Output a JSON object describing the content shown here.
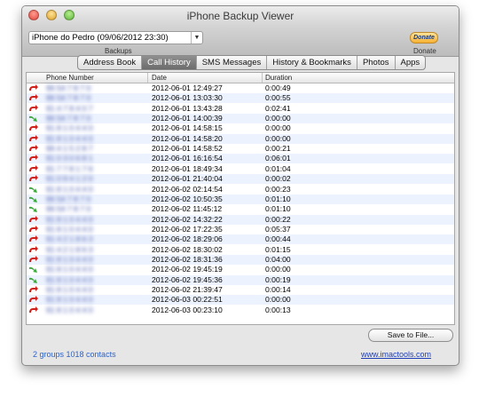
{
  "window": {
    "title": "iPhone Backup Viewer"
  },
  "toolbar": {
    "device": "iPhone do Pedro (09/06/2012 23:30)",
    "backups_label": "Backups",
    "donate_button": "Donate",
    "donate_label": "Donate"
  },
  "tabs": [
    {
      "label": "Address Book",
      "selected": false
    },
    {
      "label": "Call History",
      "selected": true
    },
    {
      "label": "SMS Messages",
      "selected": false
    },
    {
      "label": "History & Bookmarks",
      "selected": false
    },
    {
      "label": "Photos",
      "selected": false
    },
    {
      "label": "Apps",
      "selected": false
    }
  ],
  "table": {
    "columns": [
      "Phone Number",
      "Date",
      "Duration"
    ],
    "rows": [
      {
        "type": "missed",
        "number": "96 54 7 8 7 0",
        "date": "2012-06-01 12:49:27",
        "duration": "0:00:49"
      },
      {
        "type": "missed",
        "number": "96 54 7 8 7 0",
        "date": "2012-06-01 13:03:30",
        "duration": "0:00:55"
      },
      {
        "type": "missed",
        "number": "91 4 7 8 4 0 7",
        "date": "2012-06-01 13:43:28",
        "duration": "0:02:41"
      },
      {
        "type": "incoming",
        "number": "96 54 7 8 7 0",
        "date": "2012-06-01 14:00:39",
        "duration": "0:00:00"
      },
      {
        "type": "missed",
        "number": "91 8 1 0 4 4 0",
        "date": "2012-06-01 14:58:15",
        "duration": "0:00:00"
      },
      {
        "type": "missed",
        "number": "91 8 1 0 4 4 0",
        "date": "2012-06-01 14:58:20",
        "duration": "0:00:00"
      },
      {
        "type": "missed",
        "number": "96 4 1 5 2 8 7",
        "date": "2012-06-01 14:58:52",
        "duration": "0:00:21"
      },
      {
        "type": "missed",
        "number": "91 0 3 0 6 8 1",
        "date": "2012-06-01 16:16:54",
        "duration": "0:06:01"
      },
      {
        "type": "missed",
        "number": "91 7 7 8 1 7 6",
        "date": "2012-06-01 18:49:34",
        "duration": "0:01:04"
      },
      {
        "type": "missed",
        "number": "91 0 9 4 1 2 0",
        "date": "2012-06-01 21:40:04",
        "duration": "0:00:02"
      },
      {
        "type": "incoming",
        "number": "91 8 1 0 4 4 0",
        "date": "2012-06-02 02:14:54",
        "duration": "0:00:23"
      },
      {
        "type": "incoming",
        "number": "96 54 7 8 7 0",
        "date": "2012-06-02 10:50:35",
        "duration": "0:01:10"
      },
      {
        "type": "incoming",
        "number": "96 54 7 8 7 0",
        "date": "2012-06-02 11:45:12",
        "duration": "0:01:10"
      },
      {
        "type": "missed",
        "number": "91 8 1 0 4 4 0",
        "date": "2012-06-02 14:32:22",
        "duration": "0:00:22"
      },
      {
        "type": "missed",
        "number": "91 8 1 0 4 4 0",
        "date": "2012-06-02 17:22:35",
        "duration": "0:05:37"
      },
      {
        "type": "missed",
        "number": "91 4 2 1 8 6 3",
        "date": "2012-06-02 18:29:06",
        "duration": "0:00:44"
      },
      {
        "type": "missed",
        "number": "91 4 2 1 8 6 3",
        "date": "2012-06-02 18:30:02",
        "duration": "0:01:15"
      },
      {
        "type": "missed",
        "number": "91 8 1 0 4 4 0",
        "date": "2012-06-02 18:31:36",
        "duration": "0:04:00"
      },
      {
        "type": "incoming",
        "number": "91 8 1 0 4 4 0",
        "date": "2012-06-02 19:45:19",
        "duration": "0:00:00"
      },
      {
        "type": "incoming",
        "number": "91 8 1 0 4 4 0",
        "date": "2012-06-02 19:45:36",
        "duration": "0:00:19"
      },
      {
        "type": "missed",
        "number": "91 8 1 0 4 4 0",
        "date": "2012-06-02 21:39:47",
        "duration": "0:00:14"
      },
      {
        "type": "missed",
        "number": "91 8 1 0 4 4 0",
        "date": "2012-06-03 00:22:51",
        "duration": "0:00:00"
      },
      {
        "type": "missed",
        "number": "91 8 1 0 4 4 0",
        "date": "2012-06-03 00:23:10",
        "duration": "0:00:13"
      }
    ]
  },
  "footer": {
    "save_button": "Save to File...",
    "status": "2 groups 1018 contacts",
    "website": "www.imactools.com"
  },
  "colors": {
    "missed": "#d0201c",
    "incoming": "#3aa83a",
    "link": "#1f3fb8"
  },
  "icons": {
    "missed": "missed-call-icon",
    "incoming": "incoming-call-icon"
  }
}
